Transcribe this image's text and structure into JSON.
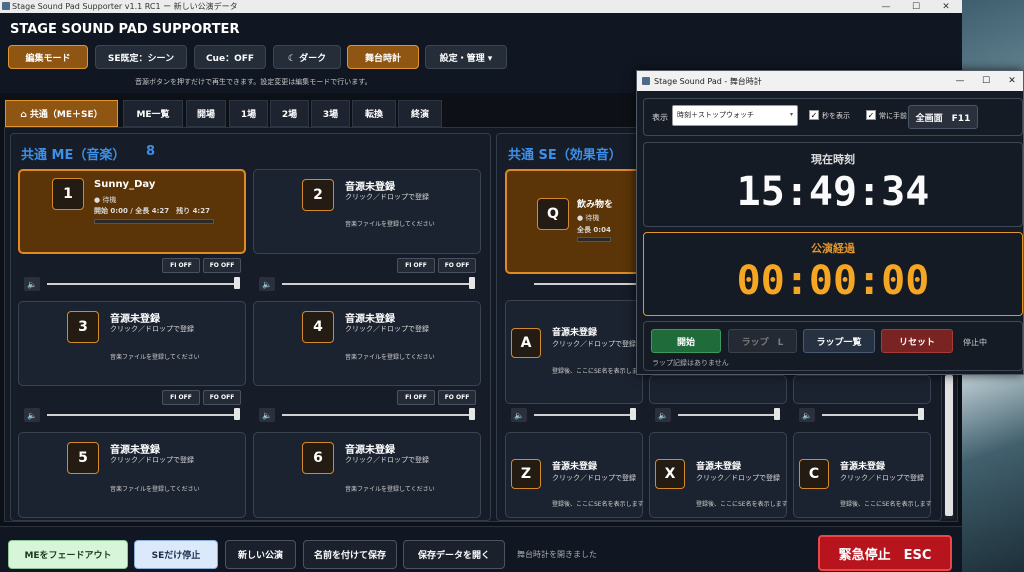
{
  "window": {
    "title": "Stage Sound Pad Supporter v1.1 RC1 ー 新しい公演データ",
    "min": "—",
    "max": "☐",
    "close": "✕"
  },
  "app": {
    "title": "STAGE SOUND PAD SUPPORTER",
    "hint": "音源ボタンを押すだけで再生できます。設定変更は編集モードで行います。"
  },
  "toolbar": {
    "edit": "編集モード",
    "se_mode": "SE既定：シーン",
    "cue": "Cue：OFF",
    "theme": "☾ ダーク",
    "clock": "舞台時計",
    "settings": "設定・管理 ▾"
  },
  "tabs": [
    "⌂ 共通（ME＋SE）",
    "ME一覧",
    "開場",
    "1場",
    "2場",
    "3場",
    "転換",
    "終演"
  ],
  "me_panel": {
    "title": "共通 ME（音楽）",
    "count": "8"
  },
  "se_panel": {
    "title": "共通 SE（効果音）"
  },
  "me_cards": [
    {
      "key": "1",
      "name": "Sunny_Day",
      "status": "● 待機",
      "time": "開始 0:00 / 全長 4:27　残り 4:27",
      "active": true,
      "fi": "FI OFF",
      "fo": "FO OFF"
    },
    {
      "key": "2",
      "name": "音源未登録",
      "sub": "クリック／ドロップで登録",
      "note": "音楽ファイルを登録してください",
      "fi": "FI OFF",
      "fo": "FO OFF"
    },
    {
      "key": "3",
      "name": "音源未登録",
      "sub": "クリック／ドロップで登録",
      "note": "音楽ファイルを登録してください",
      "fi": "FI OFF",
      "fo": "FO OFF"
    },
    {
      "key": "4",
      "name": "音源未登録",
      "sub": "クリック／ドロップで登録",
      "note": "音楽ファイルを登録してください",
      "fi": "FI OFF",
      "fo": "FO OFF"
    },
    {
      "key": "5",
      "name": "音源未登録",
      "sub": "クリック／ドロップで登録",
      "note": "音楽ファイルを登録してください"
    },
    {
      "key": "6",
      "name": "音源未登録",
      "sub": "クリック／ドロップで登録",
      "note": "音楽ファイルを登録してください"
    }
  ],
  "se_cards": [
    {
      "key": "Q",
      "name": "飲み物を",
      "status": "● 待機",
      "time": "全長 0:04",
      "active": true
    },
    {
      "key": "A",
      "name": "音源未登録",
      "sub": "クリック／ドロップで登録",
      "note": "登録後、ここにSE名を表示します"
    },
    {
      "key": "Z",
      "name": "音源未登録",
      "sub": "クリック／ドロップで登録",
      "note": "登録後、ここにSE名を表示します"
    },
    {
      "key": "X",
      "name": "音源未登録",
      "sub": "クリック／ドロップで登録",
      "note": "登録後、ここにSE名を表示します"
    },
    {
      "key": "C",
      "name": "音源未登録",
      "sub": "クリック／ドロップで登録",
      "note": "登録後、ここにSE名を表示します"
    }
  ],
  "volume_icon": "🔈",
  "bottom": {
    "me_fade": "MEをフェードアウト",
    "se_stop": "SEだけ停止",
    "new_show": "新しい公演",
    "save_as": "名前を付けて保存",
    "open": "保存データを開く",
    "status": "舞台時計を開きました",
    "emergency": "緊急停止　ESC"
  },
  "clock": {
    "title": "Stage Sound Pad - 舞台時計",
    "display_label": "表示",
    "display_value": "時刻＋ストップウォッチ",
    "show_seconds": "秒を表示",
    "always_top": "常に手前",
    "fullscreen": "全画面　F11",
    "now_label": "現在時刻",
    "now_value": "15:49:34",
    "elapsed_label": "公演経過",
    "elapsed_value": "00:00:00",
    "start": "開始",
    "lap": "ラップ　L",
    "lap_list": "ラップ一覧",
    "reset": "リセット",
    "state": "停止中",
    "lap_note": "ラップ記録はありません"
  },
  "colors": {
    "accent": "#e08a1f",
    "blue": "#3d8fe8",
    "time_yellow": "#f5a623",
    "green": "#1f6b3a",
    "red": "#7a2323"
  }
}
